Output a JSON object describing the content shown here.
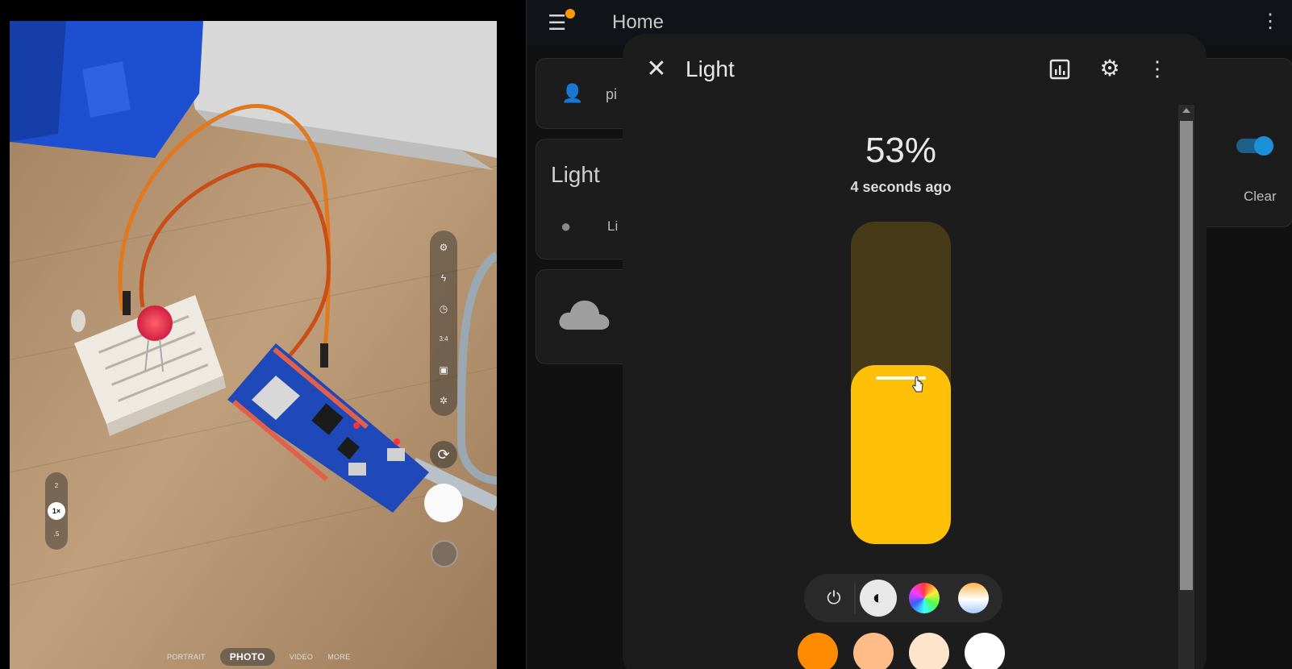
{
  "camera": {
    "toolbar_icons": [
      "settings-icon",
      "flash-icon",
      "timer-icon",
      "aspect-ratio-icon",
      "motion-photo-icon",
      "filter-icon"
    ],
    "aspect_label": "3:4",
    "switch_icon": "flip-camera-icon",
    "zoom": {
      "options": [
        "2",
        "1×",
        ".5"
      ],
      "selected": "1×"
    },
    "modes": [
      "PORTRAIT",
      "PHOTO",
      "VIDEO",
      "MORE"
    ],
    "active_mode": "PHOTO"
  },
  "ha": {
    "header": {
      "title": "Home",
      "menu_icon": "hamburger-menu-icon",
      "more_icon": "more-vert-icon"
    },
    "background": {
      "person_text": "pi",
      "light_card_title": "Light",
      "light_row_text": "Li",
      "clear_label": "Clear",
      "toggle_on": true
    },
    "dialog": {
      "title": "Light",
      "state_value": "53%",
      "last_changed": "4 seconds ago",
      "brightness_percent": 53,
      "icons": [
        "close-icon",
        "history-icon",
        "settings-icon",
        "more-vert-icon"
      ],
      "modes": [
        "power",
        "brightness",
        "color",
        "color-temp"
      ],
      "active_mode": "brightness",
      "swatches": [
        "#ff8c00",
        "#ffbb88",
        "#ffe4cc",
        "#ffffff"
      ],
      "colors": {
        "slider_fill": "#ffc107",
        "slider_track": "#463a18",
        "accent": "#1b90d8"
      }
    }
  }
}
